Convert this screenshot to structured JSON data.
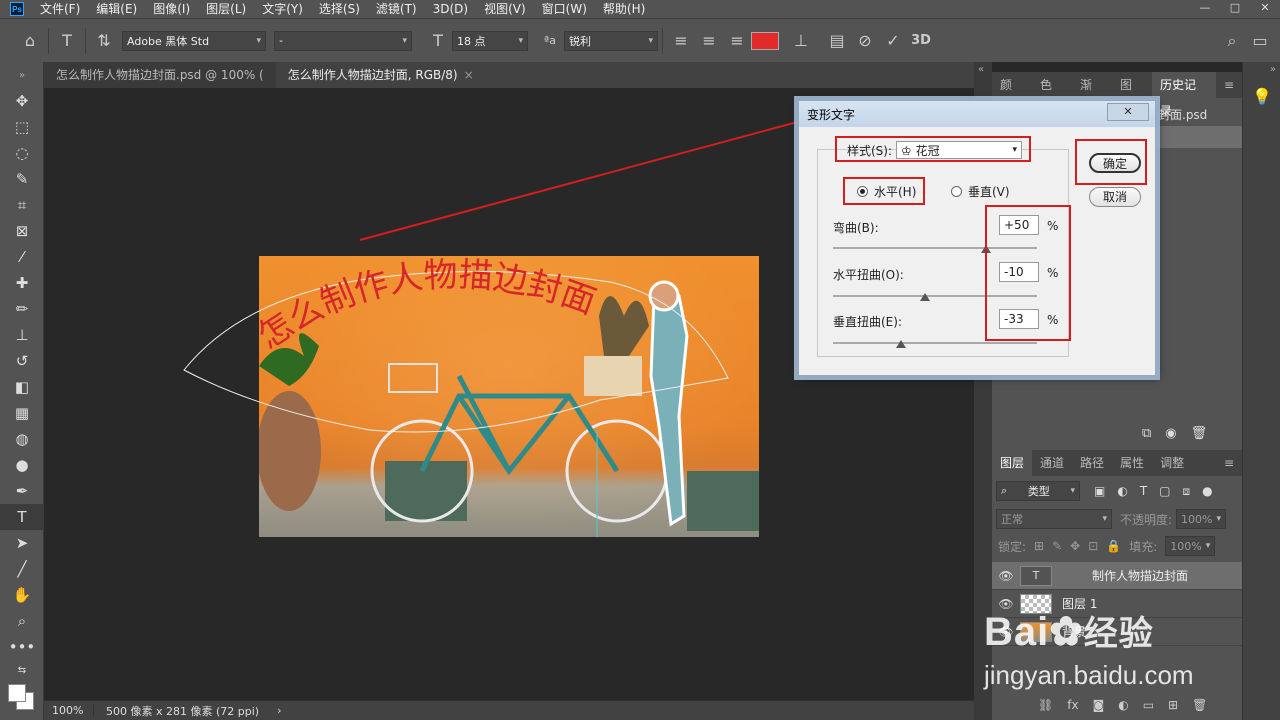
{
  "app": {
    "logo": "Ps",
    "menu": [
      "文件(F)",
      "编辑(E)",
      "图像(I)",
      "图层(L)",
      "文字(Y)",
      "选择(S)",
      "滤镜(T)",
      "3D(D)",
      "视图(V)",
      "窗口(W)",
      "帮助(H)"
    ],
    "window_controls": [
      "—",
      "□",
      "✕"
    ]
  },
  "options": {
    "font_family": "Adobe 黑体 Std",
    "font_style": "-",
    "font_size": "18 点",
    "antialias": "锐利",
    "aa_label": "ªa",
    "text_color": "#e32a2a",
    "three_d": "3D"
  },
  "document_tabs": [
    {
      "label": "怎么制作人物描边封面.psd @ 100% (",
      "active": false
    },
    {
      "label": "怎么制作人物描边封面, RGB/8)",
      "active": true,
      "close": "×"
    }
  ],
  "canvas": {
    "warp_text": "怎么制作人物描边封面"
  },
  "status": {
    "zoom": "100%",
    "doc_info": "500 像素 x 281 像素 (72 ppi)",
    "arrow": "›"
  },
  "history_panel": {
    "tabs": [
      "颜色",
      "色板",
      "渐变",
      "图案",
      "历史记录"
    ],
    "items": [
      "封面.psd",
      ""
    ]
  },
  "layers_panel": {
    "tabs": [
      "图层",
      "通道",
      "路径",
      "属性",
      "调整"
    ],
    "filter_kind": "类型",
    "blend_mode": "正常",
    "opacity_label": "不透明度:",
    "opacity_value": "100%",
    "lock_label": "锁定:",
    "fill_label": "填充:",
    "fill_value": "100%",
    "layers": [
      {
        "name": "制作人物描边封面",
        "thumb": "T",
        "selected": true
      },
      {
        "name": "图层 1",
        "thumb": "",
        "selected": false
      },
      {
        "name": "背景",
        "thumb": "",
        "selected": false
      }
    ]
  },
  "dialog": {
    "title": "变形文字",
    "close": "✕",
    "style_label": "样式(S):",
    "style_value": "花冠",
    "style_icon": "crown-icon",
    "horizontal_label": "水平(H)",
    "vertical_label": "垂直(V)",
    "orientation": "horizontal",
    "bend_label": "弯曲(B):",
    "bend_value": "+50",
    "hdist_label": "水平扭曲(O):",
    "hdist_value": "-10",
    "vdist_label": "垂直扭曲(E):",
    "vdist_value": "-33",
    "bend_fraction": 0.75,
    "hdist_fraction": 0.45,
    "vdist_fraction": 0.335,
    "percent": "%",
    "ok_label": "确定",
    "cancel_label": "取消"
  },
  "watermark": {
    "brand": "Bai",
    "brand_suffix": "经验",
    "url": "jingyan.baidu.com"
  },
  "annotation_color": "#d41e1e"
}
